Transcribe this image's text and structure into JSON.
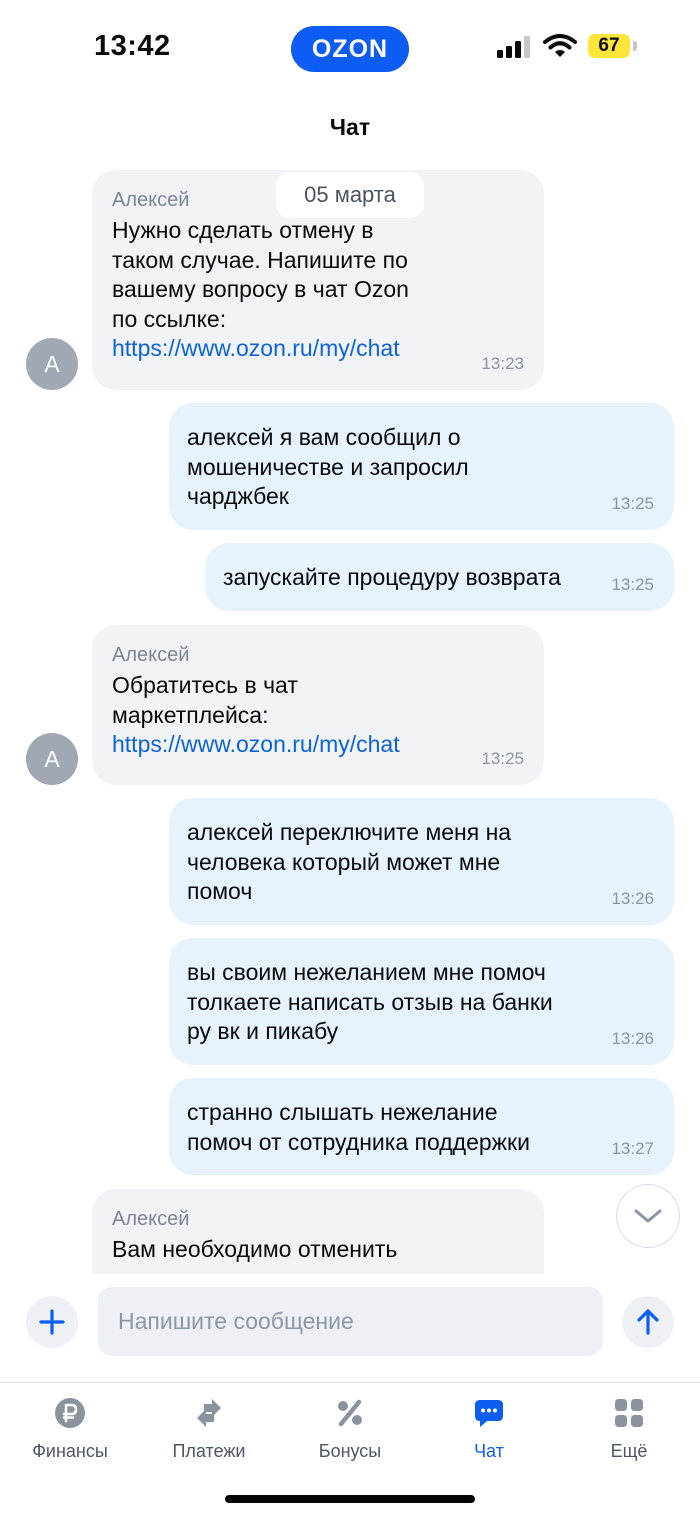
{
  "status_bar": {
    "time": "13:42",
    "logo_text": "OZON",
    "battery_level": "67"
  },
  "header": {
    "title": "Чат"
  },
  "date_separator": "05 марта",
  "messages": [
    {
      "direction": "in",
      "sender": "Алексей",
      "text_lines": [
        "Нужно сделать отмену в",
        "таком случае. Напишите по",
        "вашему вопросу в чат Ozon",
        "по ссылке:"
      ],
      "link": "https://www.ozon.ru/my/chat",
      "time": "13:23",
      "avatar_letter": "А"
    },
    {
      "direction": "out",
      "text_lines": [
        "алексей я вам сообщил о",
        "мошеничестве и запросил",
        "чарджбек"
      ],
      "time": "13:25"
    },
    {
      "direction": "out",
      "text_lines": [
        "запускайте процедуру возврата"
      ],
      "time": "13:25"
    },
    {
      "direction": "in",
      "sender": "Алексей",
      "text_lines": [
        "Обратитесь в чат",
        "маркетплейса:"
      ],
      "link": "https://www.ozon.ru/my/chat",
      "time": "13:25",
      "avatar_letter": "А"
    },
    {
      "direction": "out",
      "text_lines": [
        "алексей переключите меня на",
        "человека который может мне",
        "помоч"
      ],
      "time": "13:26"
    },
    {
      "direction": "out",
      "text_lines": [
        "вы своим нежеланием мне помоч",
        "толкаете написать отзыв на банки",
        "ру вк и пикабу"
      ],
      "time": "13:26"
    },
    {
      "direction": "out",
      "text_lines": [
        "странно слышать нежелание",
        "помоч от сотрудника поддержки"
      ],
      "time": "13:27"
    },
    {
      "direction": "in",
      "sender": "Алексей",
      "text_lines": [
        "Вам необходимо отменить"
      ]
    }
  ],
  "composer": {
    "placeholder": "Напишите сообщение"
  },
  "tabbar": {
    "items": [
      {
        "label": "Финансы",
        "icon": "ruble-icon"
      },
      {
        "label": "Платежи",
        "icon": "transfer-arrows-icon"
      },
      {
        "label": "Бонусы",
        "icon": "percent-icon"
      },
      {
        "label": "Чат",
        "icon": "chat-bubble-icon",
        "active": true
      },
      {
        "label": "Ещё",
        "icon": "grid-icon"
      }
    ]
  },
  "colors": {
    "brand": "#0d5cf4",
    "incoming_bubble": "#f2f3f7",
    "outgoing_bubble": "#e6f3fd",
    "link": "#0b63d6",
    "battery": "#fde53a"
  }
}
